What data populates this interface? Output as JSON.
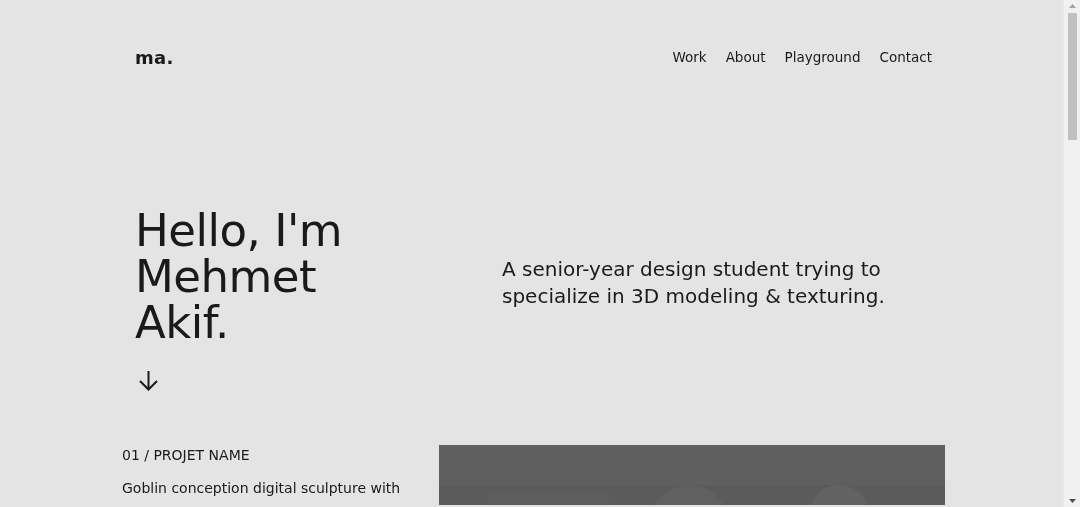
{
  "header": {
    "logo": "ma.",
    "nav": [
      {
        "label": "Work"
      },
      {
        "label": "About"
      },
      {
        "label": "Playground"
      },
      {
        "label": "Contact"
      }
    ]
  },
  "hero": {
    "title_lines": [
      "Hello, I'm",
      "Mehmet",
      "Akif."
    ],
    "tagline": "A senior-year design student trying to specialize in 3D modeling & texturing."
  },
  "project": {
    "label": "01 / PROJET NAME",
    "description": "Goblin conception digital sculpture with"
  }
}
